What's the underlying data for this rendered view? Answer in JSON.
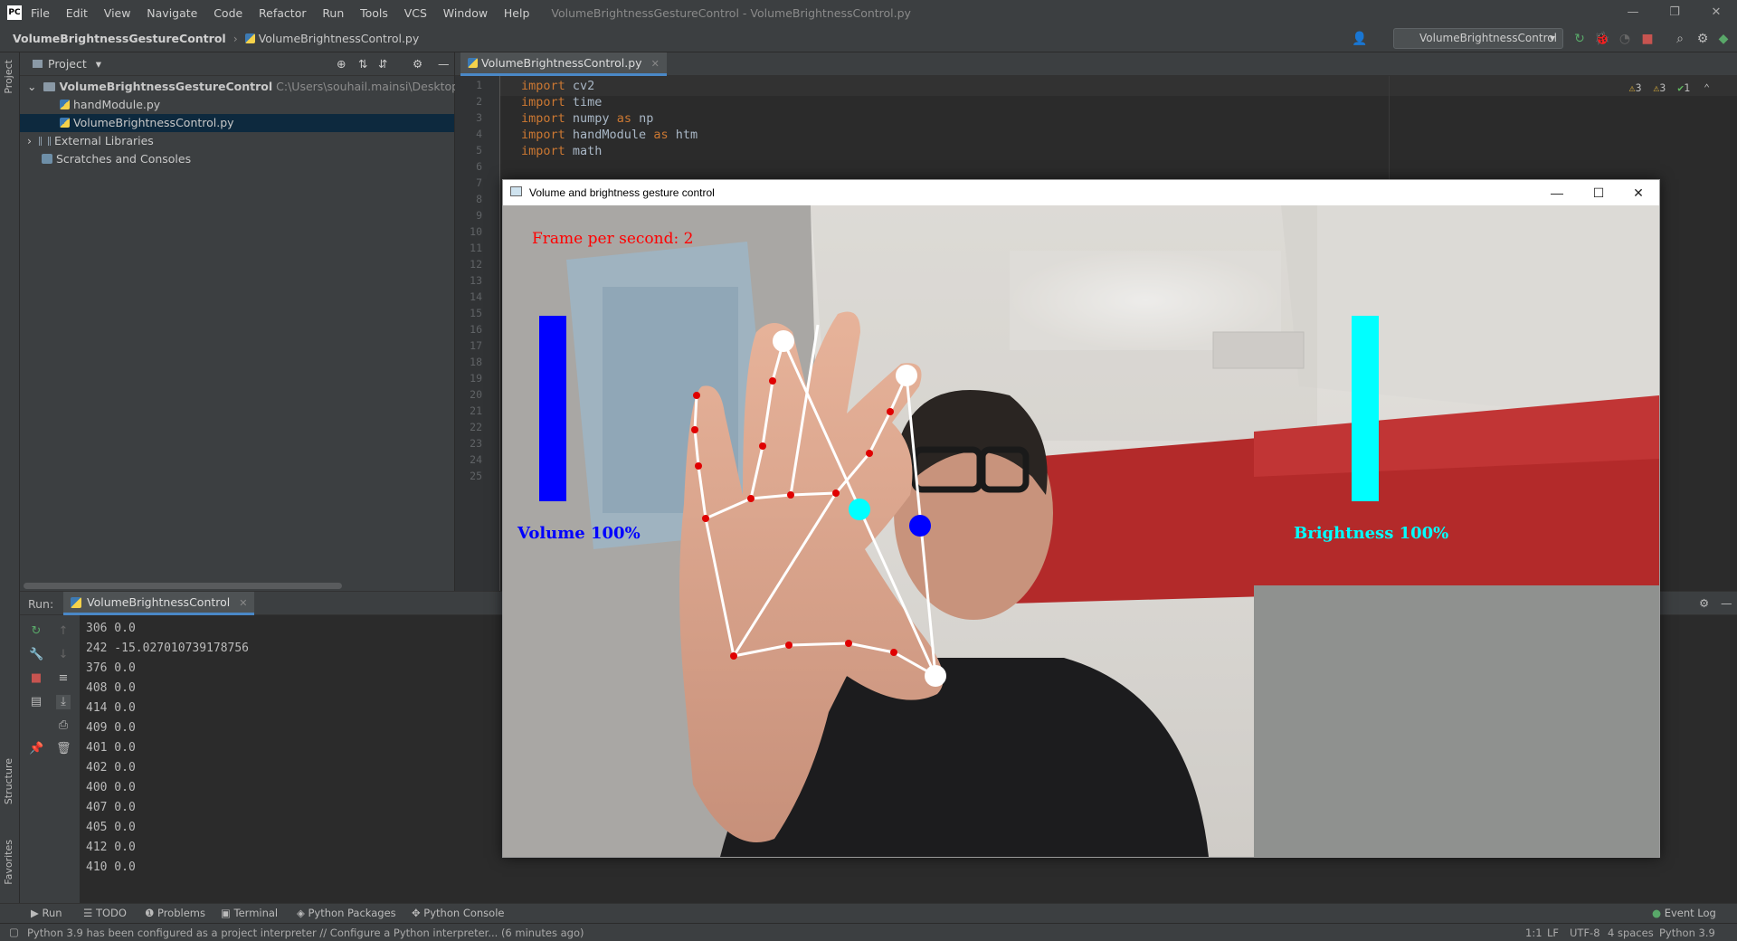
{
  "titlebar": {
    "menu": [
      "File",
      "Edit",
      "View",
      "Navigate",
      "Code",
      "Refactor",
      "Run",
      "Tools",
      "VCS",
      "Window",
      "Help"
    ],
    "window_title": "VolumeBrightnessGestureControl - VolumeBrightnessControl.py"
  },
  "navbar": {
    "project": "VolumeBrightnessGestureControl",
    "file": "VolumeBrightnessControl.py",
    "run_config": "VolumeBrightnessControl"
  },
  "left_strip": {
    "project": "Project",
    "structure": "Structure",
    "favorites": "Favorites"
  },
  "project_panel": {
    "title": "Project",
    "tree": [
      {
        "label": "VolumeBrightnessGestureControl",
        "path": "C:\\Users\\souhail.mainsi\\Desktop\\programs\\Ve"
      },
      {
        "label": "handModule.py"
      },
      {
        "label": "VolumeBrightnessControl.py"
      },
      {
        "label": "External Libraries"
      },
      {
        "label": "Scratches and Consoles"
      }
    ]
  },
  "editor": {
    "tab": "VolumeBrightnessControl.py",
    "inspections": {
      "warnings_a": "3",
      "warnings_b": "3",
      "ok": "1"
    },
    "line_numbers": [
      "1",
      "2",
      "3",
      "4",
      "5",
      "6",
      "7",
      "8",
      "9",
      "10",
      "11",
      "12",
      "13",
      "14",
      "15",
      "16",
      "17",
      "18",
      "19",
      "20",
      "21",
      "22",
      "23",
      "24",
      "25"
    ],
    "code": [
      {
        "kw": "import",
        "rest": " cv2"
      },
      {
        "kw": "import",
        "rest": " time"
      },
      {
        "kw": "import",
        "rest": " numpy ",
        "kw2": "as",
        "rest2": " np"
      },
      {
        "kw": "import",
        "rest": " handModule ",
        "kw2": "as",
        "rest2": " htm"
      },
      {
        "kw": "import",
        "rest": " math"
      }
    ]
  },
  "run_panel": {
    "label": "Run:",
    "tab": "VolumeBrightnessControl",
    "console": [
      "306 0.0",
      "242 -15.027010739178756",
      "376 0.0",
      "408 0.0",
      "414 0.0",
      "409 0.0",
      "401 0.0",
      "402 0.0",
      "400 0.0",
      "407 0.0",
      "405 0.0",
      "412 0.0",
      "410 0.0"
    ]
  },
  "bottom_tabs": [
    "Run",
    "TODO",
    "Problems",
    "Terminal",
    "Python Packages",
    "Python Console"
  ],
  "event_log": "Event Log",
  "status": {
    "message": "Python 3.9 has been configured as a project interpreter // Configure a Python interpreter... (6 minutes ago)",
    "position": "1:1",
    "line_sep": "LF",
    "encoding": "UTF-8",
    "indent": "4 spaces",
    "interpreter": "Python 3.9"
  },
  "cv_window": {
    "title": "Volume and brightness gesture control",
    "fps_text": "Frame per second: 2",
    "volume_text": "Volume 100%",
    "brightness_text": "Brightness 100%",
    "volume_percent": 100,
    "brightness_percent": 100,
    "colors": {
      "volume": "#0000ff",
      "brightness": "#00ffff",
      "fps": "#ff0000",
      "landmark": "#e00000",
      "tip": "#ffffff"
    }
  }
}
